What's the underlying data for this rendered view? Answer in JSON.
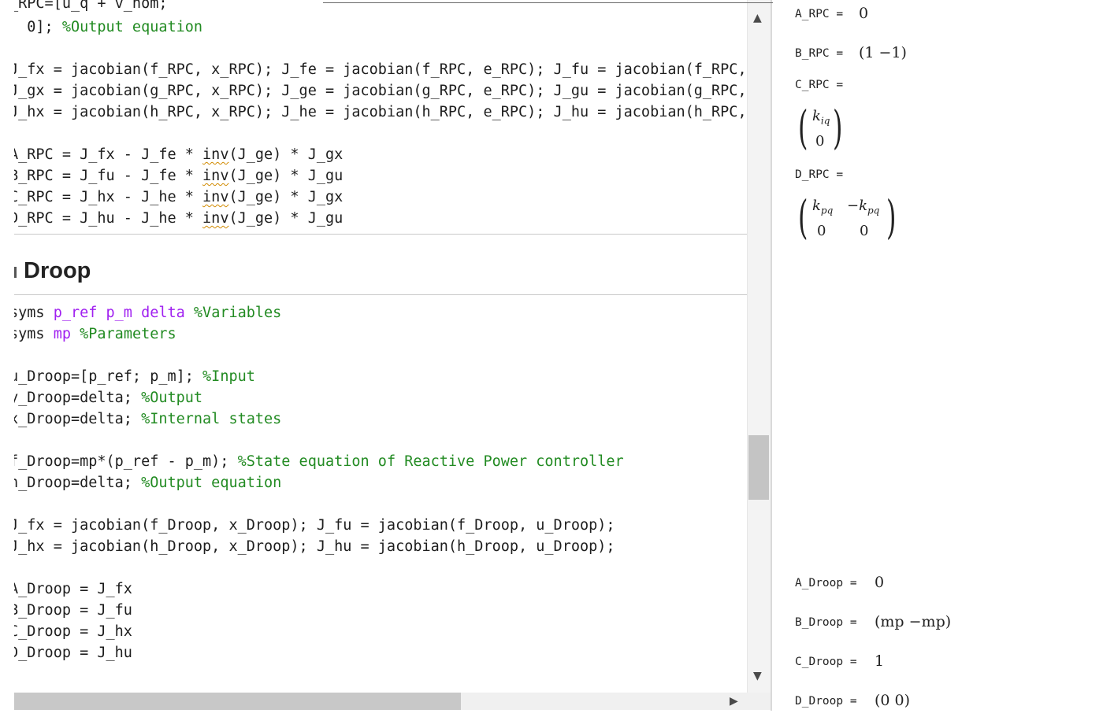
{
  "code": {
    "lines": [
      {
        "segments": [
          {
            "t": "_RPC=[u_q + v_nom;",
            "c": ""
          }
        ]
      },
      {
        "segments": [
          {
            "t": "  0]; ",
            "c": ""
          },
          {
            "t": "%Output equation",
            "c": "cm"
          }
        ]
      },
      {
        "segments": [
          {
            "t": "J_fx = jacobian(f_RPC, x_RPC); J_fe = jacobian(f_RPC, e_RPC); J_fu = jacobian(f_RPC, u_RPC);",
            "c": ""
          }
        ]
      },
      {
        "segments": [
          {
            "t": "J_gx = jacobian(g_RPC, x_RPC); J_ge = jacobian(g_RPC, e_RPC); J_gu = jacobian(g_RPC, u_RPC);",
            "c": ""
          }
        ]
      },
      {
        "segments": [
          {
            "t": "J_hx = jacobian(h_RPC, x_RPC); J_he = jacobian(h_RPC, e_RPC); J_hu = jacobian(h_RPC, u_RPC);",
            "c": ""
          }
        ]
      },
      {
        "segments": [
          {
            "t": "A_RPC = J_fx - J_fe * ",
            "c": ""
          },
          {
            "t": "inv",
            "c": "sq"
          },
          {
            "t": "(J_ge) * J_gx",
            "c": ""
          }
        ]
      },
      {
        "segments": [
          {
            "t": "B_RPC = J_fu - J_fe * ",
            "c": ""
          },
          {
            "t": "inv",
            "c": "sq"
          },
          {
            "t": "(J_ge) * J_gu",
            "c": ""
          }
        ]
      },
      {
        "segments": [
          {
            "t": "C_RPC = J_hx - J_he * ",
            "c": ""
          },
          {
            "t": "inv",
            "c": "sq"
          },
          {
            "t": "(J_ge) * J_gx",
            "c": ""
          }
        ]
      },
      {
        "segments": [
          {
            "t": "D_RPC = J_hu - J_he * ",
            "c": ""
          },
          {
            "t": "inv",
            "c": "sq"
          },
          {
            "t": "(J_ge) * J_gu",
            "c": ""
          }
        ]
      },
      {
        "segments": [
          {
            "t": "syms ",
            "c": ""
          },
          {
            "t": "p_ref p_m delta ",
            "c": "kw"
          },
          {
            "t": "%Variables",
            "c": "cm"
          }
        ]
      },
      {
        "segments": [
          {
            "t": "syms ",
            "c": ""
          },
          {
            "t": "mp ",
            "c": "kw"
          },
          {
            "t": "%Parameters",
            "c": "cm"
          }
        ]
      },
      {
        "segments": [
          {
            "t": "u_Droop=[p_ref; p_m]; ",
            "c": ""
          },
          {
            "t": "%Input",
            "c": "cm"
          }
        ]
      },
      {
        "segments": [
          {
            "t": "y_Droop=delta; ",
            "c": ""
          },
          {
            "t": "%Output",
            "c": "cm"
          }
        ]
      },
      {
        "segments": [
          {
            "t": "x_Droop=delta; ",
            "c": ""
          },
          {
            "t": "%Internal states",
            "c": "cm"
          }
        ]
      },
      {
        "segments": [
          {
            "t": "f_Droop=mp*(p_ref - p_m); ",
            "c": ""
          },
          {
            "t": "%State equation of Reactive Power controller",
            "c": "cm"
          }
        ]
      },
      {
        "segments": [
          {
            "t": "h_Droop=delta; ",
            "c": ""
          },
          {
            "t": "%Output equation",
            "c": "cm"
          }
        ]
      },
      {
        "segments": [
          {
            "t": "J_fx = jacobian(f_Droop, x_Droop); J_fu = jacobian(f_Droop, u_Droop);",
            "c": ""
          }
        ]
      },
      {
        "segments": [
          {
            "t": "J_hx = jacobian(h_Droop, x_Droop); J_hu = jacobian(h_Droop, u_Droop);",
            "c": ""
          }
        ]
      },
      {
        "segments": [
          {
            "t": "A_Droop = J_fx",
            "c": ""
          }
        ]
      },
      {
        "segments": [
          {
            "t": "B_Droop = J_fu",
            "c": ""
          }
        ]
      },
      {
        "segments": [
          {
            "t": "C_Droop = J_hx",
            "c": ""
          }
        ]
      },
      {
        "segments": [
          {
            "t": "D_Droop = J_hu",
            "c": ""
          }
        ]
      }
    ],
    "section_title": "Droop"
  },
  "output": {
    "a_rpc": {
      "label": "A_RPC  = ",
      "value": "0"
    },
    "b_rpc": {
      "label": "B_RPC  = ",
      "value": "(1   −1)"
    },
    "c_rpc": {
      "label": "C_RPC  =",
      "m11": "k",
      "m11_sub": "iq",
      "m21": "0"
    },
    "d_rpc": {
      "label": "D_RPC  =",
      "m11": "k",
      "m11_sub": "pq",
      "m12": "−k",
      "m12_sub": "pq",
      "m21": "0",
      "m22": "0"
    },
    "a_droop": {
      "label": "A_Droop  = ",
      "value": "0"
    },
    "b_droop": {
      "label": "B_Droop  = ",
      "value": "(mp   −mp)"
    },
    "c_droop": {
      "label": "C_Droop  = ",
      "value": "1"
    },
    "d_droop": {
      "label": "D_Droop  = ",
      "value": "(0   0)"
    }
  }
}
